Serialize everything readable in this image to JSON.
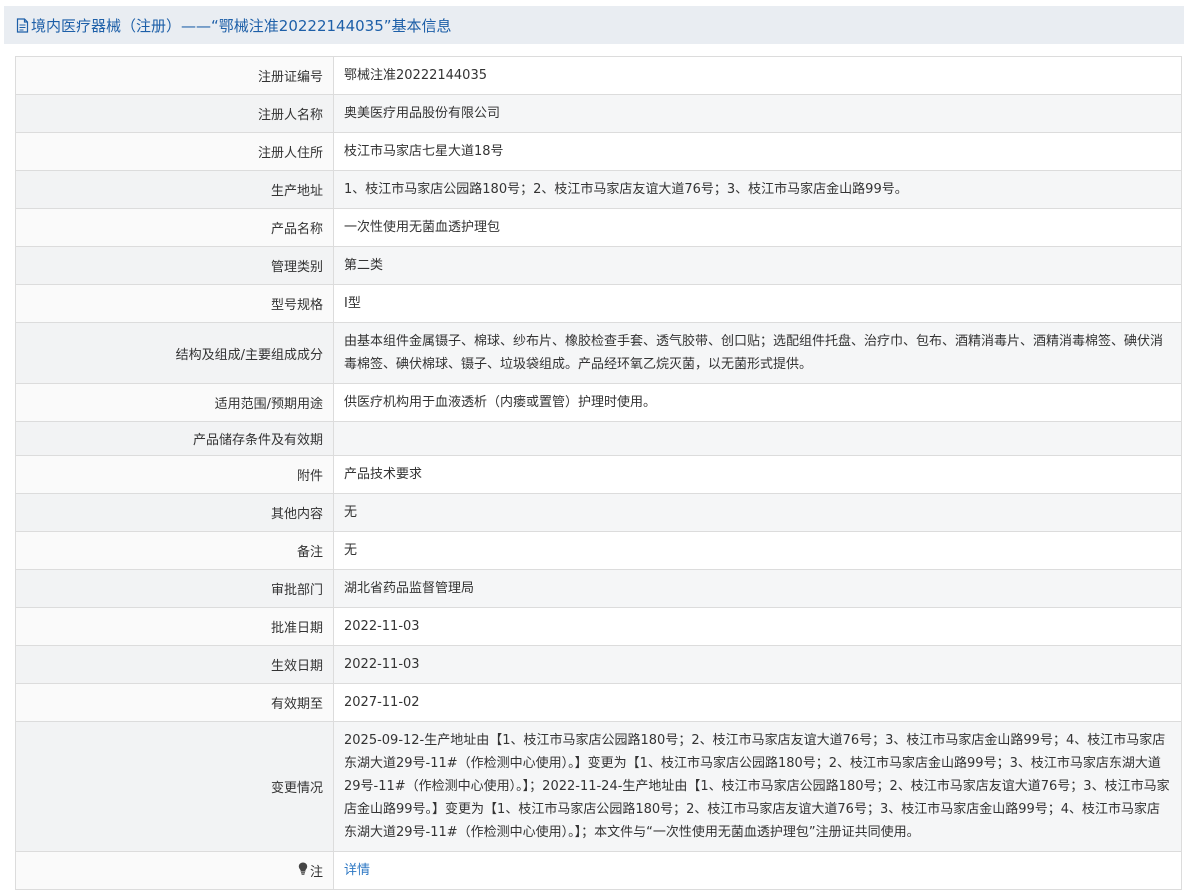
{
  "title": "境内医疗器械（注册）——“鄂械注准20222144035”基本信息",
  "rows": [
    {
      "label": "注册证编号",
      "value": "鄂械注准20222144035"
    },
    {
      "label": "注册人名称",
      "value": "奥美医疗用品股份有限公司"
    },
    {
      "label": "注册人住所",
      "value": "枝江市马家店七星大道18号"
    },
    {
      "label": "生产地址",
      "value": "1、枝江市马家店公园路180号；2、枝江市马家店友谊大道76号；3、枝江市马家店金山路99号。"
    },
    {
      "label": "产品名称",
      "value": "一次性使用无菌血透护理包"
    },
    {
      "label": "管理类别",
      "value": "第二类"
    },
    {
      "label": "型号规格",
      "value": "Ⅰ型"
    },
    {
      "label": "结构及组成/主要组成成分",
      "value": "由基本组件金属镊子、棉球、纱布片、橡胶检查手套、透气胶带、创口贴；选配组件托盘、治疗巾、包布、酒精消毒片、酒精消毒棉签、碘伏消毒棉签、碘伏棉球、镊子、垃圾袋组成。产品经环氧乙烷灭菌，以无菌形式提供。"
    },
    {
      "label": "适用范围/预期用途",
      "value": "供医疗机构用于血液透析（内瘘或置管）护理时使用。"
    },
    {
      "label": "产品储存条件及有效期",
      "value": ""
    },
    {
      "label": "附件",
      "value": "产品技术要求"
    },
    {
      "label": "其他内容",
      "value": "无"
    },
    {
      "label": "备注",
      "value": "无"
    },
    {
      "label": "审批部门",
      "value": "湖北省药品监督管理局"
    },
    {
      "label": "批准日期",
      "value": "2022-11-03"
    },
    {
      "label": "生效日期",
      "value": "2022-11-03"
    },
    {
      "label": "有效期至",
      "value": "2027-11-02"
    },
    {
      "label": "变更情况",
      "value": "2025-09-12-生产地址由【1、枝江市马家店公园路180号；2、枝江市马家店友谊大道76号；3、枝江市马家店金山路99号；4、枝江市马家店东湖大道29号-11#（作检测中心使用）。】变更为【1、枝江市马家店公园路180号；2、枝江市马家店金山路99号；3、枝江市马家店东湖大道29号-11#（作检测中心使用）。】；2022-11-24-生产地址由【1、枝江市马家店公园路180号；2、枝江市马家店友谊大道76号；3、枝江市马家店金山路99号。】变更为【1、枝江市马家店公园路180号；2、枝江市马家店友谊大道76号；3、枝江市马家店金山路99号；4、枝江市马家店东湖大道29号-11#（作检测中心使用）。】；本文件与“一次性使用无菌血透护理包”注册证共同使用。"
    }
  ],
  "note": {
    "label": "注",
    "link_text": "详情",
    "icon": "lightbulb-icon"
  },
  "colors": {
    "link": "#2e78c4",
    "title": "#1d5fa8",
    "border": "#dcdcdc",
    "row_alt": "#f5f6f7"
  }
}
